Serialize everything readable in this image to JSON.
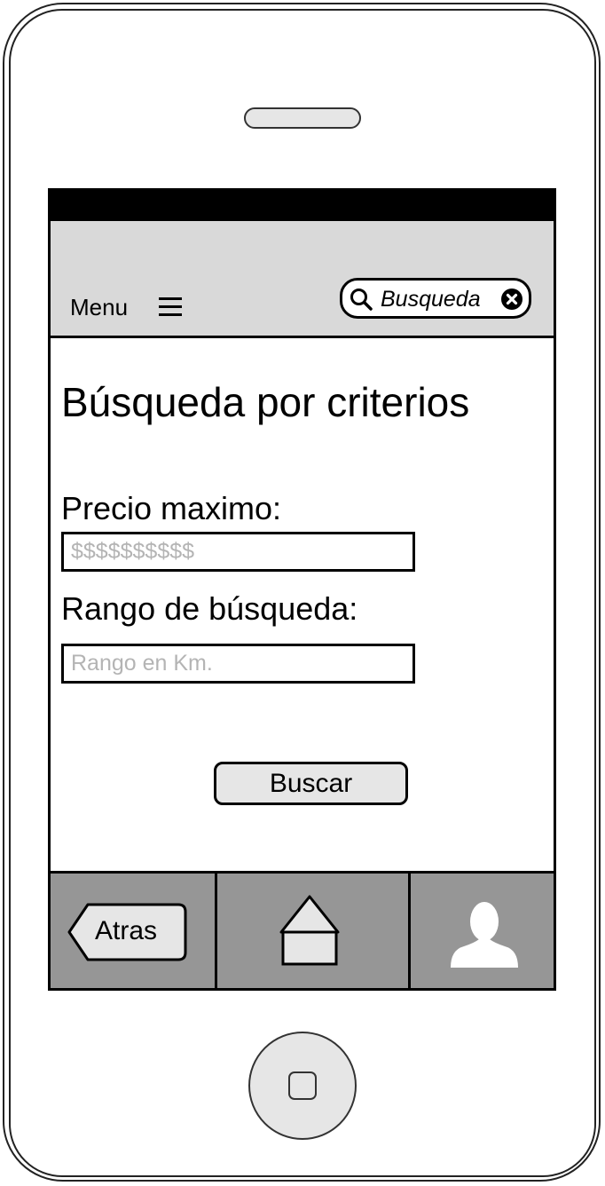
{
  "nav": {
    "menu_label": "Menu",
    "search_text": "Busqueda"
  },
  "main": {
    "title": "Búsqueda por criterios",
    "price_label": "Precio maximo:",
    "price_placeholder": "$$$$$$$$$$",
    "range_label": "Rango de búsqueda:",
    "range_placeholder": "Rango en Km.",
    "search_button": "Buscar"
  },
  "tabs": {
    "back_label": "Atras",
    "home_icon": "home-icon",
    "profile_icon": "user-icon"
  },
  "colors": {
    "nav_bg": "#d9d9d9",
    "tab_bg": "#969696",
    "button_bg": "#e6e6e6",
    "placeholder": "#b4b4b4"
  }
}
